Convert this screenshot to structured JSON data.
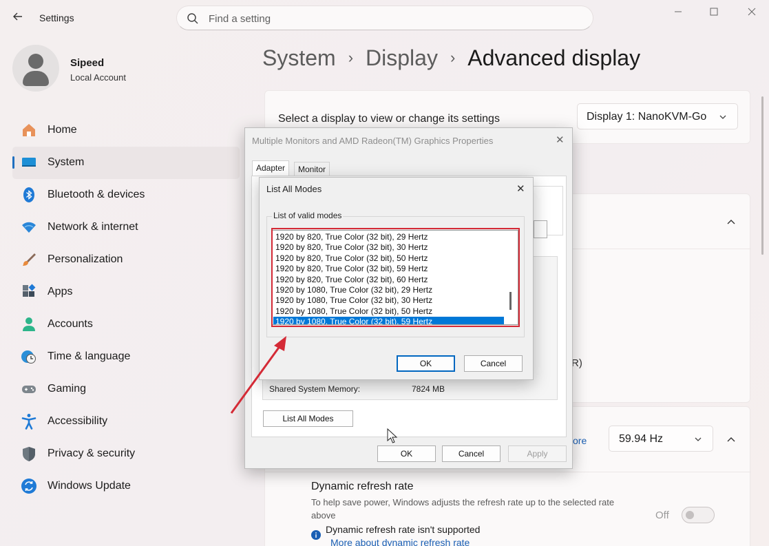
{
  "titlebar": {
    "app_title": "Settings",
    "search_placeholder": "Find a setting"
  },
  "profile": {
    "name": "Sipeed",
    "account_type": "Local Account"
  },
  "nav": [
    {
      "label": "Home",
      "icon": "home-icon",
      "active": false
    },
    {
      "label": "System",
      "icon": "system-icon",
      "active": true
    },
    {
      "label": "Bluetooth & devices",
      "icon": "bluetooth-icon",
      "active": false
    },
    {
      "label": "Network & internet",
      "icon": "wifi-icon",
      "active": false
    },
    {
      "label": "Personalization",
      "icon": "brush-icon",
      "active": false
    },
    {
      "label": "Apps",
      "icon": "apps-icon",
      "active": false
    },
    {
      "label": "Accounts",
      "icon": "person-icon",
      "active": false
    },
    {
      "label": "Time & language",
      "icon": "clock-globe-icon",
      "active": false
    },
    {
      "label": "Gaming",
      "icon": "gamepad-icon",
      "active": false
    },
    {
      "label": "Accessibility",
      "icon": "accessibility-icon",
      "active": false
    },
    {
      "label": "Privacy & security",
      "icon": "shield-icon",
      "active": false
    },
    {
      "label": "Windows Update",
      "icon": "update-icon",
      "active": false
    }
  ],
  "breadcrumb": {
    "part1": "System",
    "part2": "Display",
    "current": "Advanced display"
  },
  "display_select": {
    "label": "Select a display to view or change its settings",
    "value": "Display 1: NanoKVM-Go"
  },
  "refresh": {
    "learn_more_fragment": "ore",
    "rate_value": "59.94 Hz",
    "partial_text": "R)"
  },
  "dynamic_refresh": {
    "title": "Dynamic refresh rate",
    "description": "To help save power, Windows adjusts the refresh rate up to the selected rate above",
    "toggle_label": "Off",
    "not_supported": "Dynamic refresh rate isn't supported",
    "link": "More about dynamic refresh rate"
  },
  "properties_dialog": {
    "title": "Multiple Monitors and AMD Radeon(TM) Graphics Properties",
    "tabs": [
      "Adapter",
      "Monitor"
    ],
    "shared_memory_label": "Shared System Memory:",
    "shared_memory_value": "7824 MB",
    "list_all_modes_button": "List All Modes",
    "ok": "OK",
    "cancel": "Cancel",
    "apply": "Apply"
  },
  "modes_dialog": {
    "title": "List All Modes",
    "group_label": "List of valid modes",
    "modes": [
      "1920 by 820, True Color (32 bit), 29 Hertz",
      "1920 by 820, True Color (32 bit), 30 Hertz",
      "1920 by 820, True Color (32 bit), 50 Hertz",
      "1920 by 820, True Color (32 bit), 59 Hertz",
      "1920 by 820, True Color (32 bit), 60 Hertz",
      "1920 by 1080, True Color (32 bit), 29 Hertz",
      "1920 by 1080, True Color (32 bit), 30 Hertz",
      "1920 by 1080, True Color (32 bit), 50 Hertz",
      "1920 by 1080, True Color (32 bit), 59 Hertz"
    ],
    "selected_mode": "1920 by 1080, True Color (32 bit), 59 Hertz",
    "ok": "OK",
    "cancel": "Cancel"
  },
  "colors": {
    "accent": "#0078d7",
    "highlight": "#d42a36",
    "link": "#1a5fb4"
  }
}
